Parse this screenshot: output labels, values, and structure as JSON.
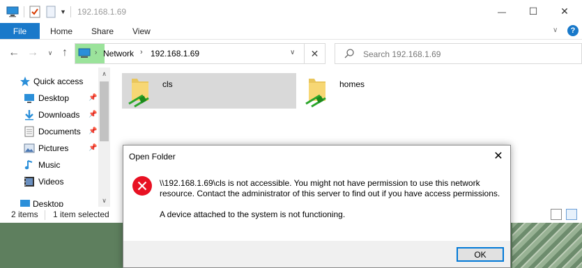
{
  "window": {
    "title": "192.168.1.69",
    "controls": {
      "minimize": "—",
      "maximize": "☐",
      "close": "✕"
    }
  },
  "ribbon": {
    "file": "File",
    "tabs": [
      "Home",
      "Share",
      "View"
    ]
  },
  "nav": {
    "breadcrumb": [
      "Network",
      "192.168.1.69"
    ],
    "search_placeholder": "Search 192.168.1.69"
  },
  "sidebar": {
    "items": [
      {
        "label": "Quick access",
        "icon": "star-icon",
        "pinned": false
      },
      {
        "label": "Desktop",
        "icon": "desktop-icon",
        "pinned": true
      },
      {
        "label": "Downloads",
        "icon": "download-icon",
        "pinned": true
      },
      {
        "label": "Documents",
        "icon": "document-icon",
        "pinned": true
      },
      {
        "label": "Pictures",
        "icon": "pictures-icon",
        "pinned": true
      },
      {
        "label": "Music",
        "icon": "music-icon",
        "pinned": false
      },
      {
        "label": "Videos",
        "icon": "video-icon",
        "pinned": false
      },
      {
        "label": "Desktop",
        "icon": "desktop-icon",
        "pinned": false
      }
    ]
  },
  "content": {
    "folders": [
      {
        "name": "cls",
        "selected": true
      },
      {
        "name": "homes",
        "selected": false
      }
    ]
  },
  "status": {
    "count": "2 items",
    "selected": "1 item selected"
  },
  "dialog": {
    "title": "Open Folder",
    "message": "\\\\192.168.1.69\\cls is not accessible. You might not have permission to use this network resource. Contact the administrator of this server to find out if you have access permissions.",
    "detail": "A device attached to the system is not functioning.",
    "ok": "OK"
  },
  "colors": {
    "accent": "#1979ca",
    "selection": "#d9d9d9",
    "error": "#e81123",
    "address_highlight": "#9be39b"
  }
}
